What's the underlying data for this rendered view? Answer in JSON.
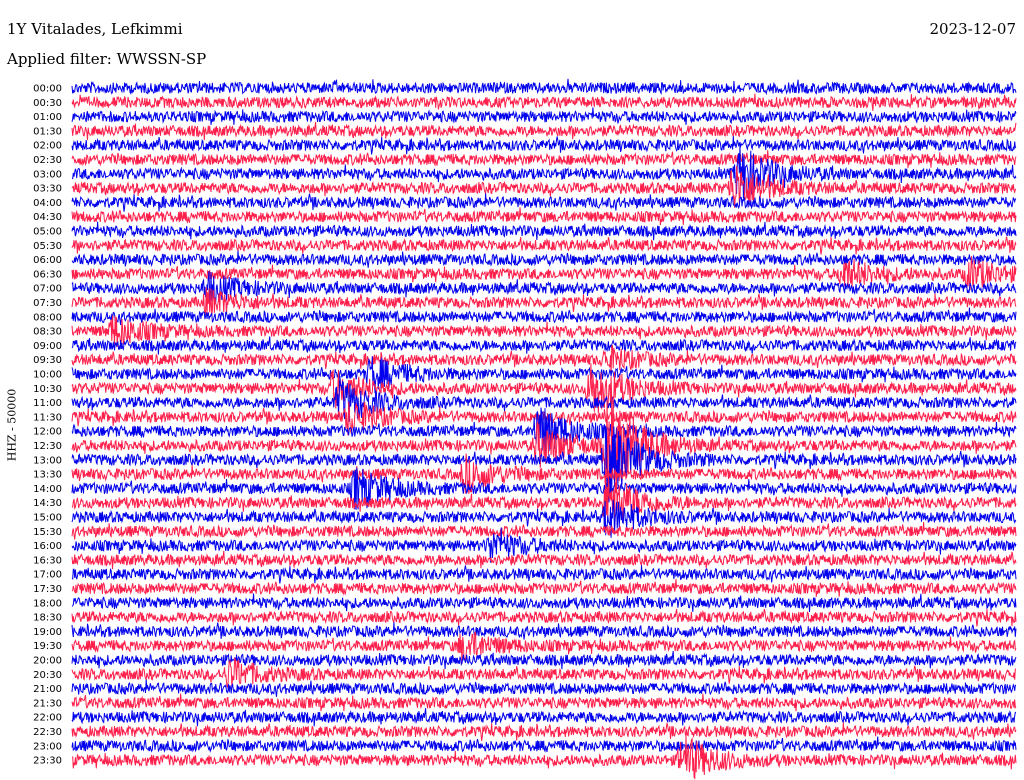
{
  "header": {
    "station": "1Y Vitalades, Lefkimmi",
    "date": "2023-12-07",
    "filter": "Applied filter: WWSSN-SP"
  },
  "chart_data": {
    "type": "line",
    "subtype": "helicorder",
    "ylabel": "HHZ - 50000",
    "row_labels": [
      "00:00",
      "00:30",
      "01:00",
      "01:30",
      "02:00",
      "02:30",
      "03:00",
      "03:30",
      "04:00",
      "04:30",
      "05:00",
      "05:30",
      "06:00",
      "06:30",
      "07:00",
      "07:30",
      "08:00",
      "08:30",
      "09:00",
      "09:30",
      "10:00",
      "10:30",
      "11:00",
      "11:30",
      "12:00",
      "12:30",
      "13:00",
      "13:30",
      "14:00",
      "14:30",
      "15:00",
      "15:30",
      "16:00",
      "16:30",
      "17:00",
      "17:30",
      "18:00",
      "18:30",
      "19:00",
      "19:30",
      "20:00",
      "20:30",
      "21:00",
      "21:30",
      "22:00",
      "22:30",
      "23:00",
      "23:30"
    ],
    "row_minutes": 30,
    "colors": [
      "#0000ee",
      "#ff1f4b"
    ],
    "events": [
      {
        "row": 6,
        "minute": 21.2,
        "amp": 3.0
      },
      {
        "row": 7,
        "minute": 21.0,
        "amp": 2.5
      },
      {
        "row": 13,
        "minute": 24.5,
        "amp": 1.6
      },
      {
        "row": 13,
        "minute": 28.5,
        "amp": 1.6
      },
      {
        "row": 14,
        "minute": 4.3,
        "amp": 1.5
      },
      {
        "row": 15,
        "minute": 4.3,
        "amp": 1.3
      },
      {
        "row": 17,
        "minute": 1.3,
        "amp": 1.6
      },
      {
        "row": 19,
        "minute": 17.0,
        "amp": 1.2
      },
      {
        "row": 20,
        "minute": 9.5,
        "amp": 1.8
      },
      {
        "row": 21,
        "minute": 8.3,
        "amp": 1.8
      },
      {
        "row": 21,
        "minute": 16.5,
        "amp": 3.0
      },
      {
        "row": 22,
        "minute": 8.5,
        "amp": 2.4
      },
      {
        "row": 23,
        "minute": 8.8,
        "amp": 1.8
      },
      {
        "row": 24,
        "minute": 14.8,
        "amp": 2.8
      },
      {
        "row": 25,
        "minute": 14.8,
        "amp": 2.2
      },
      {
        "row": 25,
        "minute": 17.0,
        "amp": 6.0
      },
      {
        "row": 26,
        "minute": 17.0,
        "amp": 4.5
      },
      {
        "row": 27,
        "minute": 12.5,
        "amp": 1.8
      },
      {
        "row": 28,
        "minute": 9.0,
        "amp": 2.2
      },
      {
        "row": 29,
        "minute": 17.0,
        "amp": 3.2
      },
      {
        "row": 30,
        "minute": 17.0,
        "amp": 2.0
      },
      {
        "row": 32,
        "minute": 13.3,
        "amp": 1.5
      },
      {
        "row": 39,
        "minute": 12.4,
        "amp": 1.5
      },
      {
        "row": 41,
        "minute": 5.0,
        "amp": 1.5
      },
      {
        "row": 47,
        "minute": 19.4,
        "amp": 2.5
      }
    ]
  }
}
